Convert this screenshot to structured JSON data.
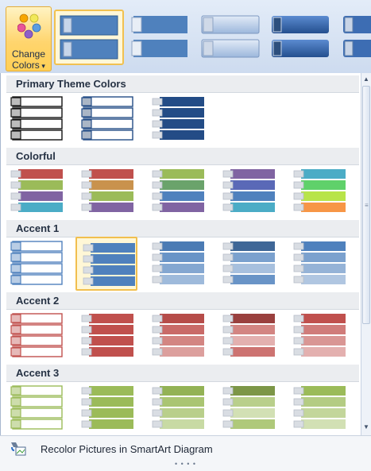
{
  "toolbar": {
    "change_colors_line1": "Change",
    "change_colors_line2": "Colors",
    "dropdown_arrow": "▾"
  },
  "colors": {
    "dark_blue": "#234c86",
    "blue": "#4f81bd",
    "red": "#c0504d",
    "green": "#9bbb59",
    "purple": "#8064a2",
    "aqua": "#4bacc6",
    "orange": "#f79646"
  },
  "sections": [
    {
      "title": "Primary Theme Colors"
    },
    {
      "title": "Colorful"
    },
    {
      "title": "Accent 1"
    },
    {
      "title": "Accent 2"
    },
    {
      "title": "Accent 3"
    }
  ],
  "footer": {
    "recolor_label": "Recolor Pictures in SmartArt Diagram"
  }
}
